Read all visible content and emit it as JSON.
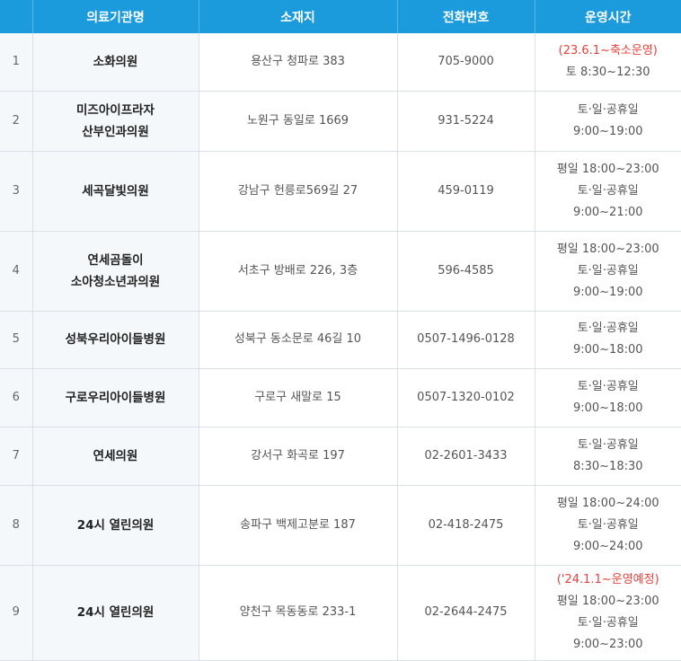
{
  "header": [
    "의료기관명",
    "소재지",
    "전화번호",
    "운영시간"
  ],
  "rows": [
    {
      "no": "1",
      "name": [
        "소화의원"
      ],
      "addr": "용산구 청파로 383",
      "phone": "705-9000",
      "note": "(23.6.1~축소운영)",
      "hours": [
        "토 8:30~12:30"
      ]
    },
    {
      "no": "2",
      "name": [
        "미즈아이프라자",
        "산부인과의원"
      ],
      "addr": "노원구 동일로 1669",
      "phone": "931-5224",
      "note": "",
      "hours": [
        "토·일·공휴일",
        "9:00~19:00"
      ]
    },
    {
      "no": "3",
      "name": [
        "세곡달빛의원"
      ],
      "addr": "강남구 헌릉로569길 27",
      "phone": "459-0119",
      "note": "",
      "hours": [
        "평일 18:00~23:00",
        "토·일·공휴일",
        "9:00~21:00"
      ]
    },
    {
      "no": "4",
      "name": [
        "연세곰돌이",
        "소아청소년과의원"
      ],
      "addr": "서초구 방배로 226, 3층",
      "phone": "596-4585",
      "note": "",
      "hours": [
        "평일 18:00~23:00",
        "토·일·공휴일",
        "9:00~19:00"
      ]
    },
    {
      "no": "5",
      "name": [
        "성북우리아이들병원"
      ],
      "addr": "성북구 동소문로 46길 10",
      "phone": "0507-1496-0128",
      "note": "",
      "hours": [
        "토·일·공휴일",
        "9:00~18:00"
      ]
    },
    {
      "no": "6",
      "name": [
        "구로우리아이들병원"
      ],
      "addr": "구로구 새말로 15",
      "phone": "0507-1320-0102",
      "note": "",
      "hours": [
        "토·일·공휴일",
        "9:00~18:00"
      ]
    },
    {
      "no": "7",
      "name": [
        "연세의원"
      ],
      "addr": "강서구 화곡로 197",
      "phone": "02-2601-3433",
      "note": "",
      "hours": [
        "토·일·공휴일",
        "8:30~18:30"
      ]
    },
    {
      "no": "8",
      "name": [
        "24시 열린의원"
      ],
      "addr": "송파구 백제고분로 187",
      "phone": "02-418-2475",
      "note": "",
      "hours": [
        "평일 18:00~24:00",
        "토·일·공휴일",
        "9:00~24:00"
      ]
    },
    {
      "no": "9",
      "name": [
        "24시 열린의원"
      ],
      "addr": "양천구 목동동로 233-1",
      "phone": "02-2644-2475",
      "note": "('24.1.1~운영예정)",
      "hours": [
        "평일 18:00~23:00",
        "토·일·공휴일",
        "9:00~23:00"
      ]
    }
  ]
}
